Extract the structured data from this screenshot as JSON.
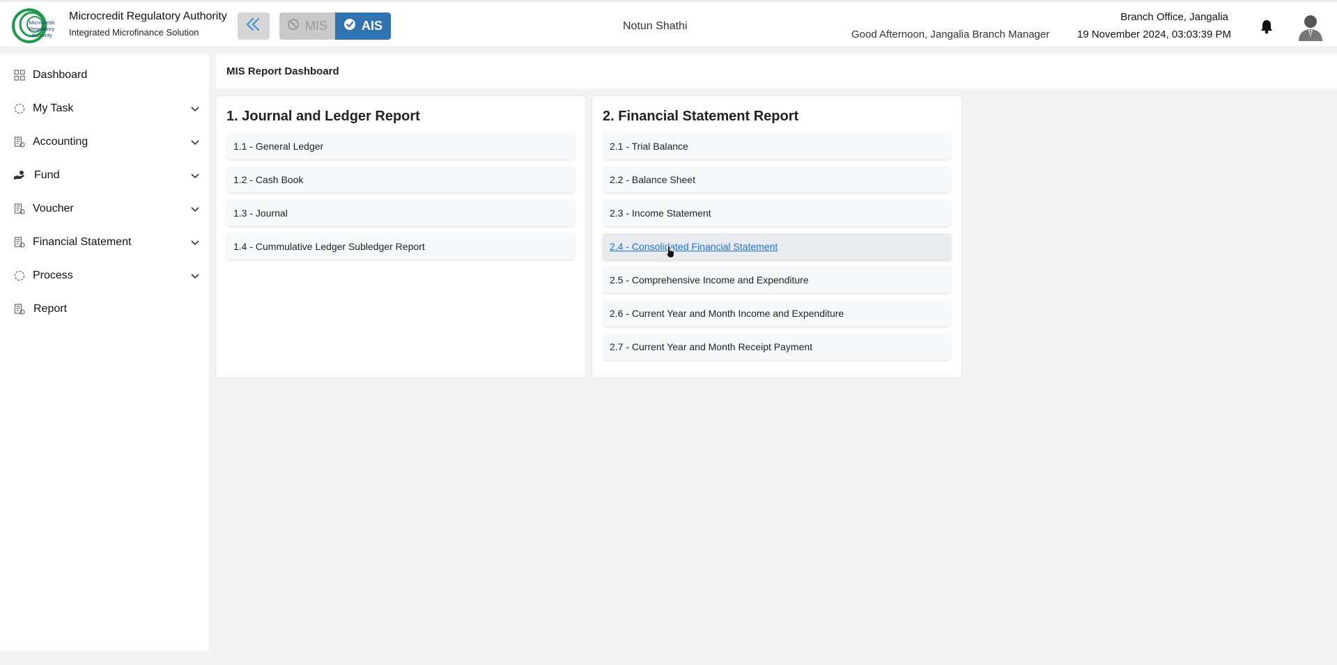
{
  "header": {
    "org_name": "Microcredit Regulatory Authority",
    "org_subtitle": "Integrated Microfinance Solution",
    "logo_text": [
      "Microcredit",
      "Regulatory",
      "Authority"
    ],
    "mis_label": "MIS",
    "ais_label": "AIS",
    "center_title": "Notun Shathi",
    "branch": "Branch Office, Jangalia",
    "greeting": "Good Afternoon, Jangalia Branch Manager",
    "datetime": "19 November 2024, 03:03:39 PM"
  },
  "sidebar": {
    "items": [
      {
        "label": "Dashboard",
        "icon": "grid-icon",
        "has_children": false
      },
      {
        "label": "My Task",
        "icon": "dashed-circle-icon",
        "has_children": true
      },
      {
        "label": "Accounting",
        "icon": "ledger-icon",
        "has_children": true
      },
      {
        "label": "Fund",
        "icon": "hand-coin-icon",
        "has_children": true
      },
      {
        "label": "Voucher",
        "icon": "ledger-icon",
        "has_children": true
      },
      {
        "label": "Financial Statement",
        "icon": "ledger-icon",
        "has_children": true
      },
      {
        "label": "Process",
        "icon": "dashed-circle-icon",
        "has_children": true
      },
      {
        "label": "Report",
        "icon": "ledger-icon",
        "has_children": false
      }
    ]
  },
  "main": {
    "title": "MIS Report Dashboard",
    "cards": [
      {
        "title": "1. Journal and Ledger Report",
        "items": [
          "1.1 - General Ledger",
          "1.2 - Cash Book",
          "1.3 - Journal",
          "1.4 - Cummulative Ledger Subledger Report"
        ]
      },
      {
        "title": "2. Financial Statement Report",
        "items": [
          "2.1 - Trial Balance",
          "2.2 - Balance Sheet",
          "2.3 - Income Statement",
          "2.4 - Consolidated Financial Statement",
          "2.5 - Comprehensive Income and Expenditure",
          "2.6 - Current Year and Month Income and Expenditure",
          "2.7 - Current Year and Month Receipt Payment"
        ],
        "hovered_index": 3
      }
    ]
  },
  "colors": {
    "accent": "#2f73b0",
    "link_hover": "#1a73d9",
    "logo_green": "#1a9a4a"
  }
}
